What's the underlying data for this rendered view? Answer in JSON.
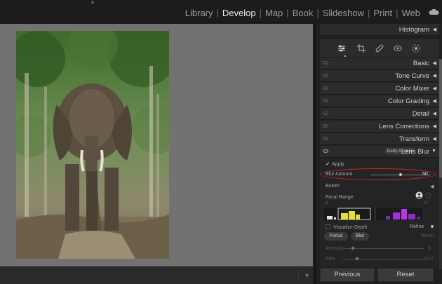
{
  "top": {
    "modules": [
      "Library",
      "Develop",
      "Map",
      "Book",
      "Slideshow",
      "Print",
      "Web"
    ],
    "active_module": "Develop"
  },
  "panel": {
    "histogram": "Histogram",
    "sections": [
      {
        "label": "Basic"
      },
      {
        "label": "Tone Curve"
      },
      {
        "label": "Color Mixer"
      },
      {
        "label": "Color Grading"
      },
      {
        "label": "Detail"
      },
      {
        "label": "Lens Corrections"
      },
      {
        "label": "Transform"
      }
    ],
    "lens_blur": {
      "title": "Lens Blur",
      "badge": "Early Access",
      "apply_label": "Apply",
      "apply_checked": true,
      "blur_amount_label": "Blur Amount",
      "blur_amount_value": "50",
      "blur_amount_fraction": 0.5,
      "bokeh_label": "Bokeh",
      "focal_range_label": "Focal Range",
      "focal_range_min": "8",
      "focal_range_max": "47",
      "visualize_depth_label": "Visualize Depth",
      "refine_label": "Refine",
      "focus_label": "Focus",
      "blur_label": "Blur",
      "reset_label": "Reset",
      "amount_label": "Amount",
      "size_label": "Size",
      "amount_value": "0",
      "size_value": "10.0"
    },
    "previous_label": "Previous",
    "reset_label": "Reset"
  }
}
